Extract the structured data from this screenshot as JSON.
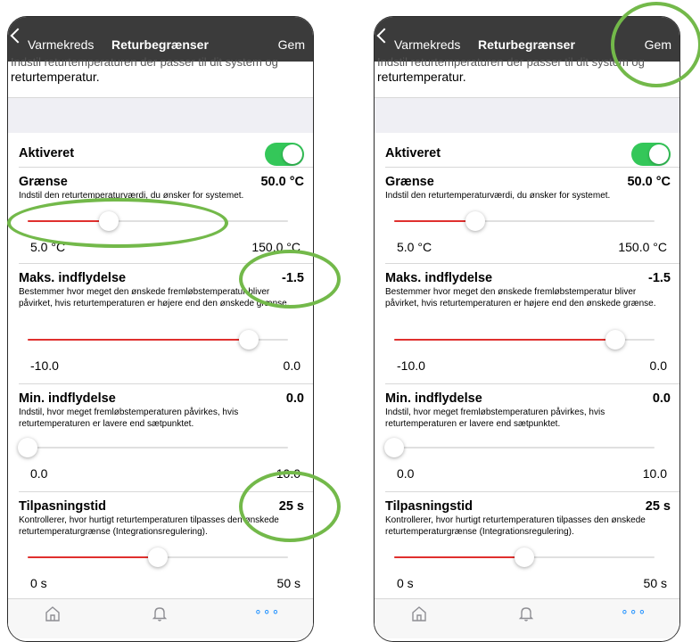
{
  "nav": {
    "back_label": "Varmekreds",
    "title": "Returbegrænser",
    "save_label": "Gem"
  },
  "intro": {
    "clipped_text": "Indstil returtemperaturen der passer til dit system og",
    "text": "returtemperatur."
  },
  "enabled": {
    "label": "Aktiveret",
    "on": true
  },
  "limit": {
    "title": "Grænse",
    "value": "50.0 °C",
    "description": "Indstil den returtemperaturværdi, du ønsker for systemet.",
    "min": "5.0 °C",
    "max": "150.0 °C",
    "level": 0.31
  },
  "max_influence": {
    "title": "Maks. indflydelse",
    "value": "-1.5",
    "description": "Bestemmer hvor meget den ønskede fremløbstemperatur bliver påvirket, hvis returtemperaturen er højere end den ønskede grænse.",
    "min": "-10.0",
    "max": "0.0",
    "level": 0.85
  },
  "min_influence": {
    "title": "Min. indflydelse",
    "value": "0.0",
    "description": "Indstil, hvor meget fremløbstemperaturen påvirkes, hvis returtemperaturen er lavere end sætpunktet.",
    "min": "0.0",
    "max": "10.0",
    "level": 0.0
  },
  "adapt_time": {
    "title": "Tilpasningstid",
    "value": "25 s",
    "description": "Kontrollerer, hvor hurtigt returtemperaturen tilpasses den ønskede returtemperaturgrænse (Integrationsregulering).",
    "min": "0 s",
    "max": "50 s",
    "level": 0.5
  },
  "tabbar": {
    "home_icon": "home-icon",
    "bell_icon": "bell-icon",
    "more_label": "∘∘∘"
  },
  "colors": {
    "navbar": "#3b3b3b",
    "toggle_on": "#34c759",
    "slider_fill": "#e0302e",
    "accent": "#1e90ff",
    "annotation": "#73b94a"
  }
}
